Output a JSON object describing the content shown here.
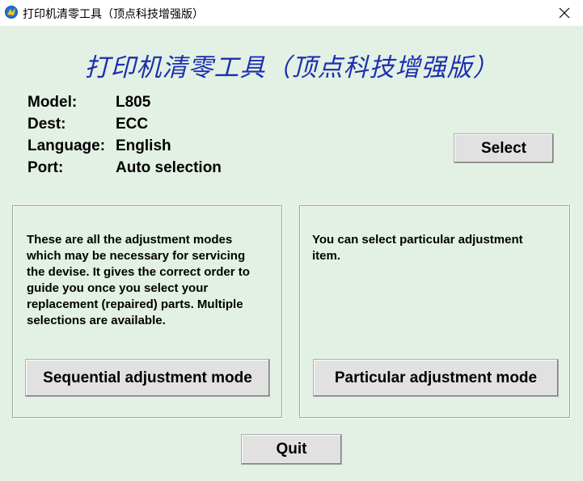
{
  "window": {
    "title": "打印机清零工具（顶点科技增强版）"
  },
  "header": {
    "heading": "打印机清零工具（顶点科技增强版）"
  },
  "info": {
    "model_label": "Model:",
    "model_value": "L805",
    "dest_label": "Dest:",
    "dest_value": "ECC",
    "language_label": "Language:",
    "language_value": "English",
    "port_label": "Port:",
    "port_value": "Auto selection"
  },
  "buttons": {
    "select": "Select",
    "sequential": "Sequential adjustment mode",
    "particular": "Particular adjustment mode",
    "quit": "Quit"
  },
  "panels": {
    "left_lines": [
      "These are all the adjustment modes",
      "which may be necessary for servicing",
      "the devise. It gives the correct order to",
      "guide you once you select your",
      "replacement (repaired) parts. Multiple",
      "selections are available."
    ],
    "right_lines": [
      "You can select particular adjustment",
      "item."
    ]
  },
  "icons": {
    "app": "app-icon",
    "close": "close-icon"
  },
  "colors": {
    "background": "#e3f1e4",
    "heading": "#1c2fb0",
    "button_face": "#e1e1e1"
  }
}
